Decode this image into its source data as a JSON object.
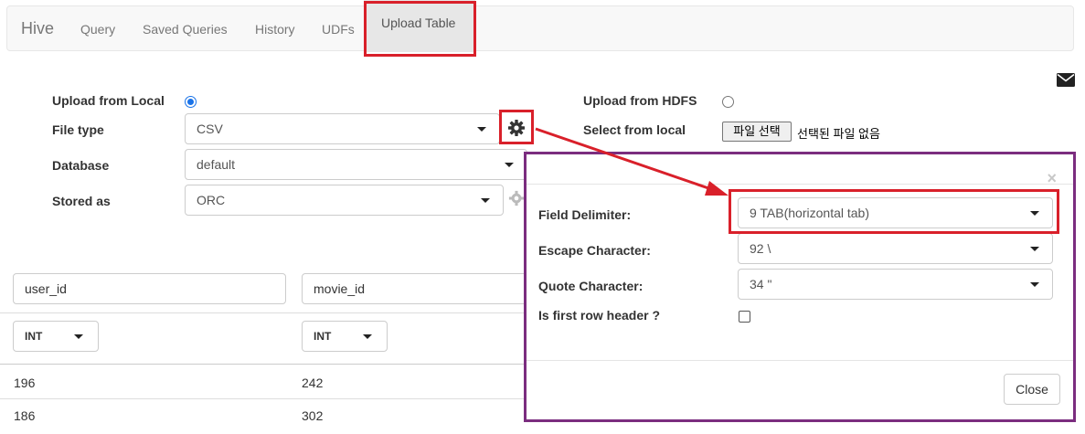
{
  "navbar": {
    "brand": "Hive",
    "items": [
      "Query",
      "Saved Queries",
      "History",
      "UDFs"
    ],
    "active": "Upload Table"
  },
  "form": {
    "upload_local_label": "Upload from Local",
    "upload_hdfs_label": "Upload from HDFS",
    "file_type_label": "File type",
    "file_type_value": "CSV",
    "select_local_label": "Select from local",
    "file_button": "파일 선택",
    "file_status": "선택된 파일 없음",
    "database_label": "Database",
    "database_value": "default",
    "stored_as_label": "Stored as",
    "stored_as_value": "ORC"
  },
  "table": {
    "columns": [
      {
        "name": "user_id",
        "type": "INT"
      },
      {
        "name": "movie_id",
        "type": "INT"
      }
    ],
    "rows": [
      [
        "196",
        "242"
      ],
      [
        "186",
        "302"
      ]
    ]
  },
  "modal": {
    "field_delimiter_label": "Field Delimiter:",
    "field_delimiter_value": "9 TAB(horizontal tab)",
    "escape_char_label": "Escape Character:",
    "escape_char_value": "92 \\",
    "quote_char_label": "Quote Character:",
    "quote_char_value": "34 \"",
    "first_row_header_label": "Is first row header ?",
    "close_x": "×",
    "close_button": "Close"
  },
  "colors": {
    "highlight_red": "#d9202a",
    "modal_border": "#7b2d7f",
    "radio_blue": "#1a73e8"
  }
}
